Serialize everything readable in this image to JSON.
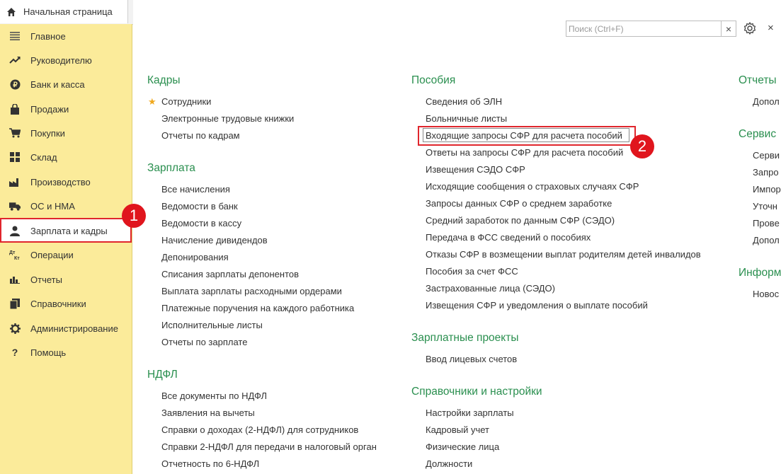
{
  "top": {
    "home_tab": "Начальная страница",
    "search_placeholder": "Поиск (Ctrl+F)"
  },
  "sidebar": {
    "items": [
      {
        "label": "Главное",
        "icon": "menu-lines-icon"
      },
      {
        "label": "Руководителю",
        "icon": "trend-line-icon"
      },
      {
        "label": "Банк и касса",
        "icon": "ruble-coin-icon"
      },
      {
        "label": "Продажи",
        "icon": "shopping-bag-icon"
      },
      {
        "label": "Покупки",
        "icon": "shopping-cart-icon"
      },
      {
        "label": "Склад",
        "icon": "warehouse-grid-icon"
      },
      {
        "label": "Производство",
        "icon": "factory-icon"
      },
      {
        "label": "ОС и НМА",
        "icon": "truck-icon"
      },
      {
        "label": "Зарплата и кадры",
        "icon": "person-icon"
      },
      {
        "label": "Операции",
        "icon": "dt-kt-icon"
      },
      {
        "label": "Отчеты",
        "icon": "bar-chart-icon"
      },
      {
        "label": "Справочники",
        "icon": "books-icon"
      },
      {
        "label": "Администрирование",
        "icon": "gear-icon"
      },
      {
        "label": "Помощь",
        "icon": "question-icon"
      }
    ],
    "icon_text": {
      "dt": "Дт",
      "kt": "Кт",
      "help": "?"
    }
  },
  "annotations": {
    "badge1": "1",
    "badge2": "2"
  },
  "col1": {
    "kadry": {
      "title": "Кадры",
      "items": [
        "Сотрудники",
        "Электронные трудовые книжки",
        "Отчеты по кадрам"
      ]
    },
    "zarplata": {
      "title": "Зарплата",
      "items": [
        "Все начисления",
        "Ведомости в банк",
        "Ведомости в кассу",
        "Начисление дивидендов",
        "Депонирования",
        "Списания зарплаты депонентов",
        "Выплата зарплаты расходными ордерами",
        "Платежные поручения на каждого работника",
        "Исполнительные листы",
        "Отчеты по зарплате"
      ]
    },
    "ndfl": {
      "title": "НДФЛ",
      "items": [
        "Все документы по НДФЛ",
        "Заявления на вычеты",
        "Справки о доходах (2-НДФЛ) для сотрудников",
        "Справки 2-НДФЛ для передачи в налоговый орган",
        "Отчетность по 6-НДФЛ"
      ]
    }
  },
  "col2": {
    "posobiya": {
      "title": "Пособия",
      "items": [
        "Сведения об ЭЛН",
        "Больничные листы",
        "Входящие запросы СФР для расчета пособий",
        "Ответы на запросы СФР для расчета пособий",
        "Извещения СЭДО СФР",
        "Исходящие сообщения о страховых случаях СФР",
        "Запросы данных СФР о среднем заработке",
        "Средний заработок по данным СФР (СЭДО)",
        "Передача в ФСС сведений о пособиях",
        "Отказы СФР в возмещении выплат родителям детей инвалидов",
        "Пособия за счет ФСС",
        "Застрахованные лица (СЭДО)",
        "Извещения СФР и уведомления о выплате пособий"
      ]
    },
    "proekty": {
      "title": "Зарплатные проекты",
      "items": [
        "Ввод лицевых счетов"
      ]
    },
    "sprav": {
      "title": "Справочники и настройки",
      "items": [
        "Настройки зарплаты",
        "Кадровый учет",
        "Физические лица",
        "Должности"
      ]
    }
  },
  "col3": {
    "otchety": {
      "title": "Отчеты",
      "items": [
        "Допол"
      ]
    },
    "servis": {
      "title": "Сервис",
      "items": [
        "Серви",
        "Запро",
        "Импор",
        "Уточн",
        "Прове",
        "Допол"
      ]
    },
    "inform": {
      "title": "Информ",
      "items": [
        "Новос"
      ]
    }
  },
  "colors": {
    "accent_green": "#2a8f4f",
    "sidebar_bg": "#fbeb9a",
    "highlight_red": "#e0262d"
  }
}
